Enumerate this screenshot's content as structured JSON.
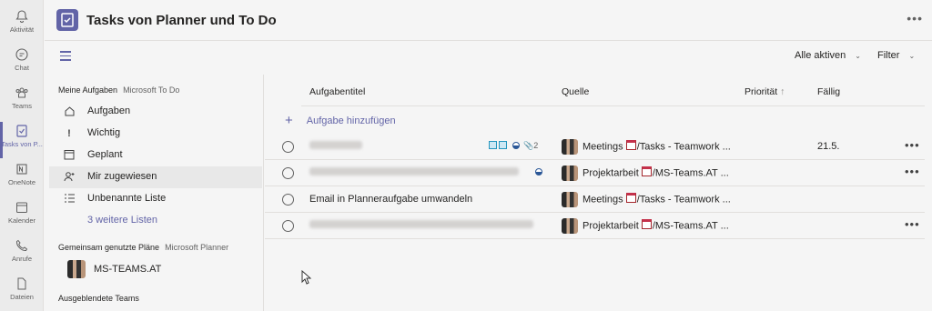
{
  "rail": [
    {
      "label": "Aktivität",
      "icon": "bell-icon"
    },
    {
      "label": "Chat",
      "icon": "chat-icon"
    },
    {
      "label": "Teams",
      "icon": "teams-icon"
    },
    {
      "label": "Tasks von P...",
      "icon": "tasks-icon",
      "active": true
    },
    {
      "label": "OneNote",
      "icon": "onenote-icon"
    },
    {
      "label": "Kalender",
      "icon": "calendar-icon"
    },
    {
      "label": "Anrufe",
      "icon": "phone-icon"
    },
    {
      "label": "Dateien",
      "icon": "file-icon"
    }
  ],
  "header": {
    "title": "Tasks von Planner und To Do",
    "more": "•••"
  },
  "toolbar": {
    "filter_all": "Alle aktiven",
    "filter": "Filter"
  },
  "sidebar": {
    "my_tasks_title": "Meine Aufgaben",
    "my_tasks_sub": "Microsoft To Do",
    "items": [
      {
        "label": "Aufgaben",
        "icon": "home-icon"
      },
      {
        "label": "Wichtig",
        "icon": "exclamation-icon"
      },
      {
        "label": "Geplant",
        "icon": "calendar-icon"
      },
      {
        "label": "Mir zugewiesen",
        "icon": "assigned-user-icon"
      },
      {
        "label": "Unbenannte Liste",
        "icon": "list-icon"
      },
      {
        "label": "3 weitere Listen"
      }
    ],
    "shared_title": "Gemeinsam genutzte Pläne",
    "shared_sub": "Microsoft Planner",
    "plan": "MS-TEAMS.AT",
    "hidden_title": "Ausgeblendete Teams"
  },
  "table": {
    "columns": {
      "title": "Aufgabentitel",
      "source": "Quelle",
      "priority": "Priorität",
      "priority_arrow": "↑",
      "due": "Fällig"
    },
    "add_label": "Aufgabe hinzufügen",
    "rows": [
      {
        "title": "",
        "source": "Meetings",
        "path": "/Tasks - Teamwork ...",
        "due": "21.5.",
        "attach": "2"
      },
      {
        "title": "",
        "source": "Projektarbeit",
        "path": "/MS-Teams.AT ...",
        "due": ""
      },
      {
        "title": "Email in Planneraufgabe umwandeln",
        "source": "Meetings",
        "path": "/Tasks - Teamwork ...",
        "due": ""
      },
      {
        "title": "",
        "source": "Projektarbeit",
        "path": "/MS-Teams.AT ...",
        "due": ""
      }
    ],
    "more": "•••"
  },
  "colors": {
    "accent": "#6264a7",
    "background": "#f5f5f5"
  }
}
